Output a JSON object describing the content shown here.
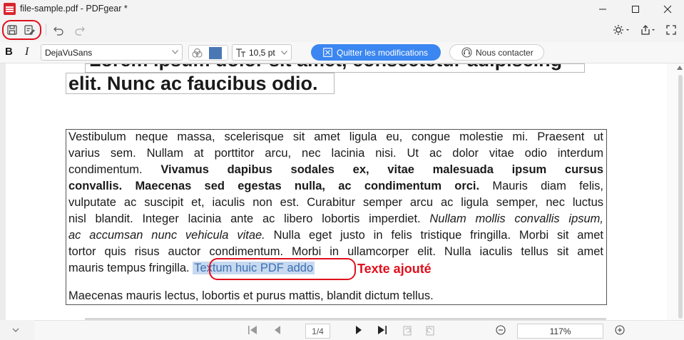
{
  "window": {
    "title": "file-sample.pdf - PDFgear *"
  },
  "quick_toolbar": {
    "save_icon": "save-icon",
    "save_as_icon": "save-as-icon",
    "undo_icon": "undo-icon",
    "redo_icon": "redo-icon",
    "theme_icon": "sun-icon",
    "share_icon": "share-icon",
    "fullscreen_icon": "fullscreen-icon"
  },
  "edit_toolbar": {
    "bold_label": "B",
    "italic_label": "I",
    "font_family": "DejaVuSans",
    "font_color": "#4a78b5",
    "font_size": "10,5 pt",
    "quit_label": "Quitter les modifications",
    "contact_label": "Nous contacter"
  },
  "document": {
    "heading_line1": "Lorem ipsum dolor sit amet, consectetur adipiscing",
    "heading_line2": "elit. Nunc ac faucibus odio.",
    "p1": {
      "l1": "Vestibulum neque massa, scelerisque sit amet ligula eu, congue molestie mi. Praesent ut",
      "l2": "varius sem. Nullam at porttitor arcu, nec lacinia nisi. Ut ac dolor vitae odio interdum",
      "l3_plain": "condimentum. ",
      "l3_bold": "Vivamus dapibus sodales ex, vitae malesuada ipsum cursus",
      "l4_bold": "convallis. Maecenas sed egestas nulla, ac condimentum orci.",
      "l4_plain": " Mauris diam felis,",
      "l5": "vulputate ac suscipit et, iaculis non est. Curabitur semper arcu ac ligula semper, nec luctus",
      "l6_plain": "nisl blandit. Integer lacinia ante ac libero lobortis imperdiet. ",
      "l6_italic": "Nullam mollis convallis ipsum,",
      "l7_italic": "ac accumsan nunc vehicula vitae.",
      "l7_plain": " Nulla eget justo in felis tristique fringilla. Morbi sit amet",
      "l8": "tortor quis risus auctor condimentum. Morbi in ullamcorper elit. Nulla iaculis tellus sit amet",
      "l9_plain": "mauris tempus fringilla. ",
      "added_text": "Textum huic PDF addo"
    },
    "p2": "Maecenas mauris lectus, lobortis et purus mattis, blandit dictum tellus.",
    "annotation_label": "Texte ajouté"
  },
  "statusbar": {
    "page_indicator": "1/4",
    "zoom": "117%"
  },
  "colors": {
    "accent": "#3b86f0",
    "highlight_circle": "#e0101c",
    "added_text": "#3b6fb1"
  }
}
